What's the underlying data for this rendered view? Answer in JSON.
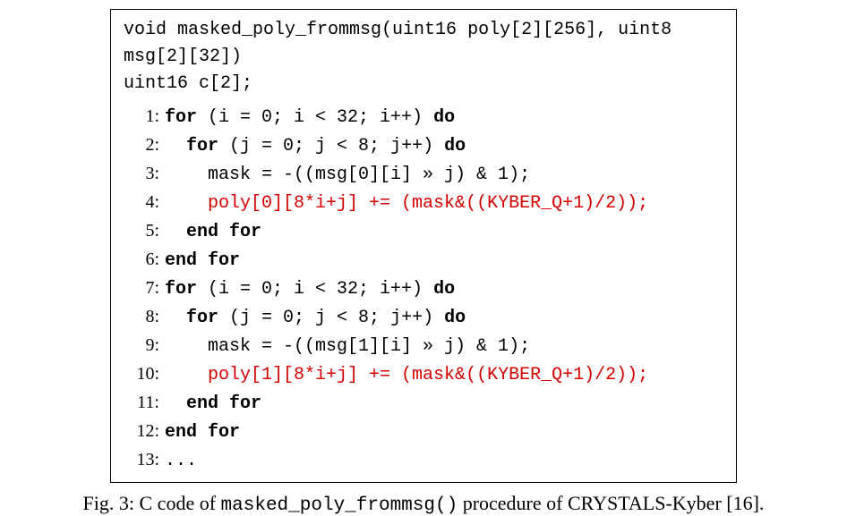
{
  "signature": {
    "line1": "void masked_poly_frommsg(uint16 poly[2][256], uint8",
    "line2": "msg[2][32])",
    "line3": "uint16 c[2];"
  },
  "lines": [
    {
      "num": " 1:",
      "segments": [
        {
          "t": "for",
          "b": true
        },
        {
          "t": " (i = 0; i < 32; i++) "
        },
        {
          "t": "do",
          "b": true
        }
      ]
    },
    {
      "num": " 2:",
      "segments": [
        {
          "t": "  "
        },
        {
          "t": "for",
          "b": true
        },
        {
          "t": " (j = 0; j < 8; j++) "
        },
        {
          "t": "do",
          "b": true
        }
      ]
    },
    {
      "num": " 3:",
      "segments": [
        {
          "t": "    mask = -((msg[0][i] » j) & 1);"
        }
      ]
    },
    {
      "num": " 4:",
      "segments": [
        {
          "t": "    "
        },
        {
          "t": "poly[0][8*i+j] += (mask&((KYBER_Q+1)/2));",
          "r": true
        }
      ]
    },
    {
      "num": " 5:",
      "segments": [
        {
          "t": "  "
        },
        {
          "t": "end for",
          "b": true
        }
      ]
    },
    {
      "num": " 6:",
      "segments": [
        {
          "t": "end for",
          "b": true
        }
      ]
    },
    {
      "num": " 7:",
      "segments": [
        {
          "t": "for",
          "b": true
        },
        {
          "t": " (i = 0; i < 32; i++) "
        },
        {
          "t": "do",
          "b": true
        }
      ]
    },
    {
      "num": " 8:",
      "segments": [
        {
          "t": "  "
        },
        {
          "t": "for",
          "b": true
        },
        {
          "t": " (j = 0; j < 8; j++) "
        },
        {
          "t": "do",
          "b": true
        }
      ]
    },
    {
      "num": " 9:",
      "segments": [
        {
          "t": "    mask = -((msg[1][i] » j) & 1);"
        }
      ]
    },
    {
      "num": "10:",
      "segments": [
        {
          "t": "    "
        },
        {
          "t": "poly[1][8*i+j] += (mask&((KYBER_Q+1)/2));",
          "r": true
        }
      ]
    },
    {
      "num": "11:",
      "segments": [
        {
          "t": "  "
        },
        {
          "t": "end for",
          "b": true
        }
      ]
    },
    {
      "num": "12:",
      "segments": [
        {
          "t": "end for",
          "b": true
        }
      ]
    },
    {
      "num": "13:",
      "segments": [
        {
          "t": "..."
        }
      ]
    }
  ],
  "caption": {
    "prefix": "Fig. 3: C code of ",
    "func": "masked_poly_frommsg()",
    "suffix": " procedure of CRYSTALS-Kyber [16]."
  }
}
